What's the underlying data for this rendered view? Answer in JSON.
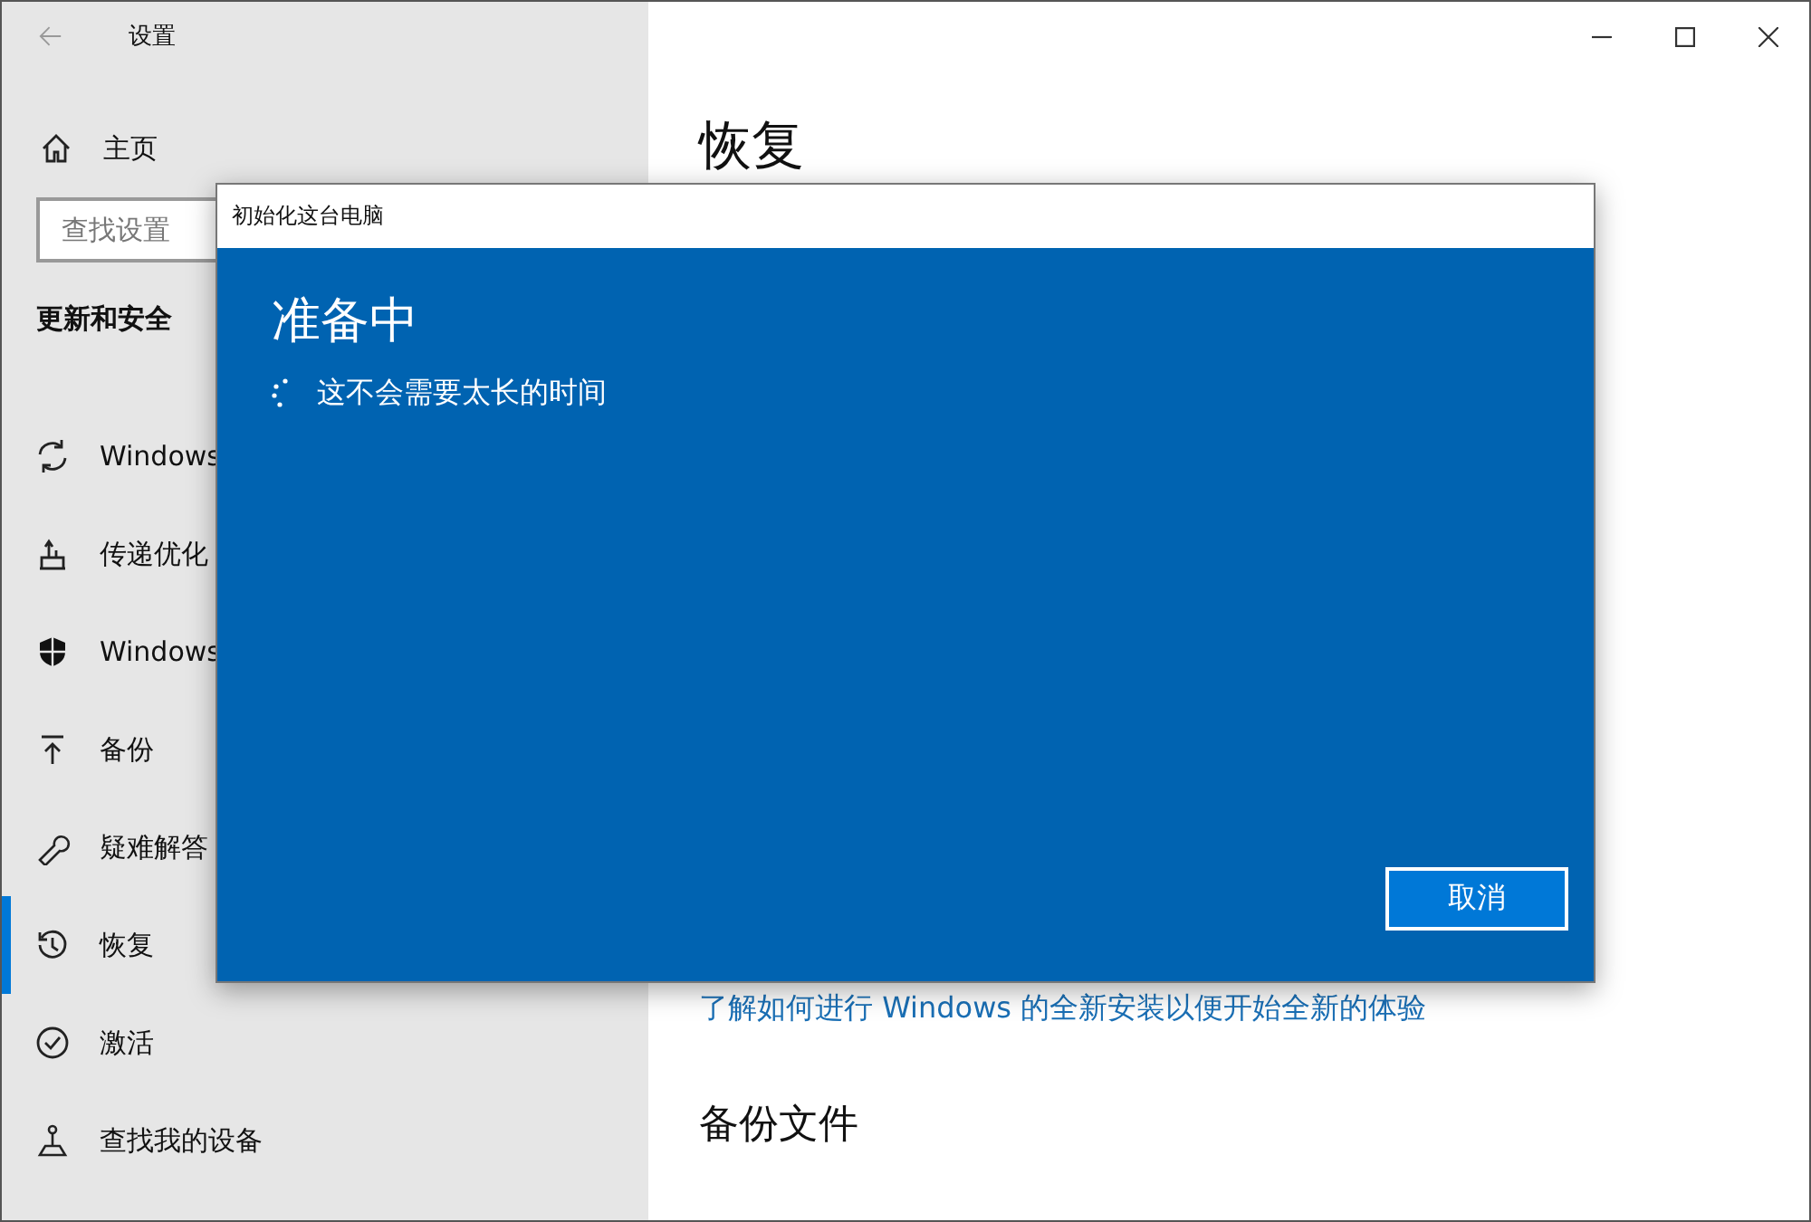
{
  "window": {
    "title": "设置"
  },
  "sidebar": {
    "home": "主页",
    "search": {
      "placeholder": "查找设置"
    },
    "section": "更新和安全",
    "items": [
      {
        "label": "Windows",
        "selected": false
      },
      {
        "label": "传递优化",
        "selected": false
      },
      {
        "label": "Windows",
        "selected": false
      },
      {
        "label": "备份",
        "selected": false
      },
      {
        "label": "疑难解答",
        "selected": false
      },
      {
        "label": "恢复",
        "selected": true
      },
      {
        "label": "激活",
        "selected": false
      },
      {
        "label": "查找我的设备",
        "selected": false
      }
    ]
  },
  "content": {
    "heading": "恢复",
    "link": "了解如何进行 Windows 的全新安装以便开始全新的体验",
    "section": "备份文件"
  },
  "dialog": {
    "title": "初始化这台电脑",
    "heading": "准备中",
    "message": "这不会需要太长的时间",
    "button": "取消"
  }
}
